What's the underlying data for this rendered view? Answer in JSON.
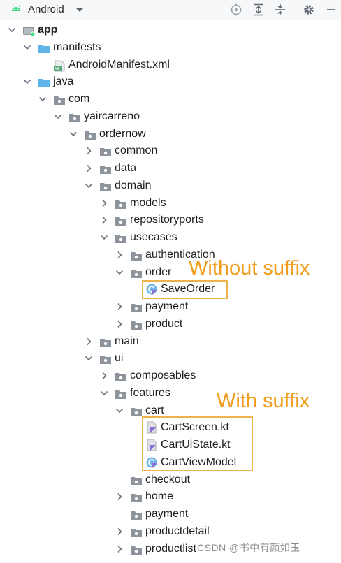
{
  "toolbar": {
    "view_label": "Android",
    "icons": [
      "android-icon",
      "dropdown-icon",
      "locate-icon",
      "expand-all-icon",
      "collapse-all-icon",
      "settings-icon",
      "hide-icon"
    ]
  },
  "tree": [
    {
      "label": "app",
      "depth": 0,
      "expanded": true,
      "icon": "module",
      "bold": true
    },
    {
      "label": "manifests",
      "depth": 1,
      "expanded": true,
      "icon": "folder-blue"
    },
    {
      "label": "AndroidManifest.xml",
      "depth": 2,
      "leaf": true,
      "icon": "manifest"
    },
    {
      "label": "java",
      "depth": 1,
      "expanded": true,
      "icon": "folder-blue"
    },
    {
      "label": "com",
      "depth": 2,
      "expanded": true,
      "icon": "package"
    },
    {
      "label": "yaircarreno",
      "depth": 3,
      "expanded": true,
      "icon": "package"
    },
    {
      "label": "ordernow",
      "depth": 4,
      "expanded": true,
      "icon": "package"
    },
    {
      "label": "common",
      "depth": 5,
      "expanded": false,
      "icon": "package"
    },
    {
      "label": "data",
      "depth": 5,
      "expanded": false,
      "icon": "package"
    },
    {
      "label": "domain",
      "depth": 5,
      "expanded": true,
      "icon": "package"
    },
    {
      "label": "models",
      "depth": 6,
      "expanded": false,
      "icon": "package"
    },
    {
      "label": "repositoryports",
      "depth": 6,
      "expanded": false,
      "icon": "package"
    },
    {
      "label": "usecases",
      "depth": 6,
      "expanded": true,
      "icon": "package"
    },
    {
      "label": "authentication",
      "depth": 7,
      "expanded": false,
      "icon": "package"
    },
    {
      "label": "order",
      "depth": 7,
      "expanded": true,
      "icon": "package"
    },
    {
      "label": "SaveOrder",
      "depth": 8,
      "leaf": true,
      "icon": "kotlin-class"
    },
    {
      "label": "payment",
      "depth": 7,
      "expanded": false,
      "icon": "package"
    },
    {
      "label": "product",
      "depth": 7,
      "expanded": false,
      "icon": "package"
    },
    {
      "label": "main",
      "depth": 5,
      "expanded": false,
      "icon": "package"
    },
    {
      "label": "ui",
      "depth": 5,
      "expanded": true,
      "icon": "package"
    },
    {
      "label": "composables",
      "depth": 6,
      "expanded": false,
      "icon": "package"
    },
    {
      "label": "features",
      "depth": 6,
      "expanded": true,
      "icon": "package"
    },
    {
      "label": "cart",
      "depth": 7,
      "expanded": true,
      "icon": "package"
    },
    {
      "label": "CartScreen.kt",
      "depth": 8,
      "leaf": true,
      "icon": "kotlin-file"
    },
    {
      "label": "CartUiState.kt",
      "depth": 8,
      "leaf": true,
      "icon": "kotlin-file"
    },
    {
      "label": "CartViewModel",
      "depth": 8,
      "leaf": true,
      "icon": "kotlin-class"
    },
    {
      "label": "checkout",
      "depth": 7,
      "leaf": true,
      "icon": "package"
    },
    {
      "label": "home",
      "depth": 7,
      "expanded": false,
      "icon": "package"
    },
    {
      "label": "payment",
      "depth": 7,
      "leaf": true,
      "icon": "package"
    },
    {
      "label": "productdetail",
      "depth": 7,
      "expanded": false,
      "icon": "package"
    },
    {
      "label": "productlist",
      "depth": 7,
      "expanded": false,
      "icon": "package"
    }
  ],
  "annotations": {
    "without_suffix": "Without suffix",
    "with_suffix": "With suffix"
  },
  "watermark": "CSDN @书中有颜如玉",
  "colors": {
    "annotation": "#f29d1e",
    "highlight_border": "#f0b24a",
    "folder_blue": "#5fb4e8",
    "package_gray": "#8e949c",
    "kotlin_purple": "#8f6fd1",
    "toolbar_bg": "#f7f8fa"
  }
}
